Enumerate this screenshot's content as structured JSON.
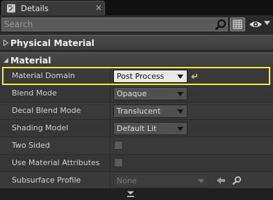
{
  "tab": {
    "icon": "details-icon",
    "label": "Details",
    "close": "×"
  },
  "search": {
    "placeholder": "Search",
    "icon": "search-icon"
  },
  "toolbar": {
    "grid_icon": "property-matrix-icon",
    "eye_icon": "view-options-icon"
  },
  "categories": [
    {
      "label": "Physical Material",
      "expanded": false
    },
    {
      "label": "Material",
      "expanded": true
    }
  ],
  "properties": [
    {
      "label": "Material Domain",
      "type": "combo",
      "value": "Post Process",
      "active": true,
      "highlighted": true
    },
    {
      "label": "Blend Mode",
      "type": "combo",
      "value": "Opaque"
    },
    {
      "label": "Decal Blend Mode",
      "type": "combo",
      "value": "Translucent"
    },
    {
      "label": "Shading Model",
      "type": "combo",
      "value": "Default Lit"
    },
    {
      "label": "Two Sided",
      "type": "checkbox",
      "checked": false
    },
    {
      "label": "Use Material Attributes",
      "type": "checkbox",
      "checked": false
    },
    {
      "label": "Subsurface Profile",
      "type": "asset",
      "value": "None",
      "disabled": true
    }
  ],
  "colors": {
    "highlight": "#f0f030",
    "panel": "#2d2d2d"
  }
}
